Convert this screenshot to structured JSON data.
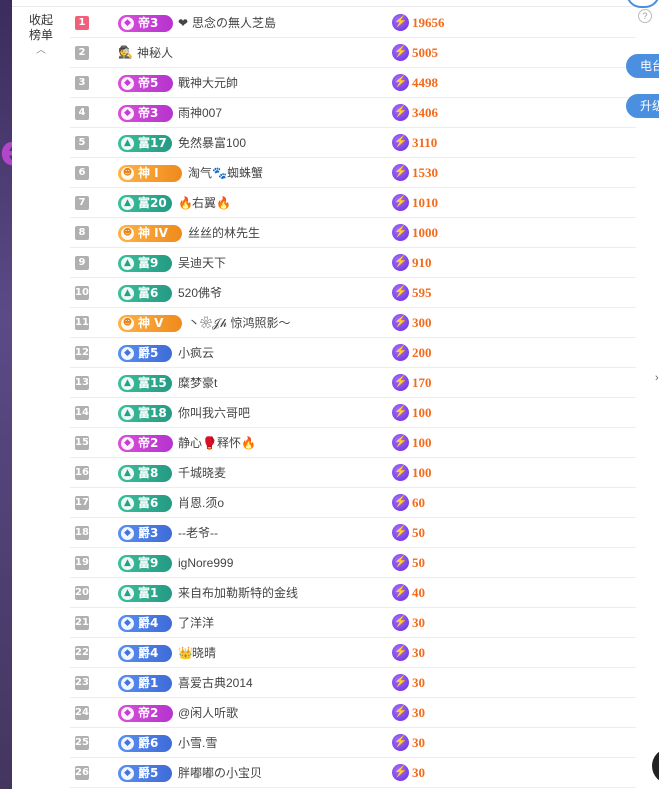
{
  "page": {
    "collapse_label": "收起\n榜单",
    "collapse_line1": "收起",
    "collapse_line2": "榜单",
    "chevron": "︿",
    "side_big_letter": "e"
  },
  "side_buttons": [
    {
      "label": "电台"
    },
    {
      "label": "升级"
    }
  ],
  "help_icon": "?",
  "colors": {
    "score": "#f46a1a",
    "di": "#c23ed3",
    "fu": "#27a088",
    "jue": "#4473da",
    "shen": "#f08a1c",
    "top_rank": "#f0607a",
    "side_button": "#4a8fe0"
  },
  "rows": [
    {
      "rank": "1",
      "badge": "帝3",
      "type": "di",
      "pre": "❤",
      "name": "思念の無人芝島",
      "score": "19656"
    },
    {
      "rank": "2",
      "badge": "",
      "type": "none",
      "pre": "🕵",
      "name": "神秘人",
      "score": "5005"
    },
    {
      "rank": "3",
      "badge": "帝5",
      "type": "di",
      "pre": "",
      "name": "戰神大元帥",
      "score": "4498"
    },
    {
      "rank": "4",
      "badge": "帝3",
      "type": "di",
      "pre": "",
      "name": "雨神007",
      "score": "3406"
    },
    {
      "rank": "5",
      "badge": "富17",
      "type": "fu",
      "pre": "",
      "name": "免然暴富100",
      "score": "3110"
    },
    {
      "rank": "6",
      "badge": "神 I",
      "type": "shen",
      "pre": "",
      "name": "淘气🐾蜘蛛蟹",
      "score": "1530"
    },
    {
      "rank": "7",
      "badge": "富20",
      "type": "fu",
      "pre": "🔥",
      "name": "右翼🔥",
      "score": "1010"
    },
    {
      "rank": "8",
      "badge": "神 IV",
      "type": "shen",
      "pre": "",
      "name": "丝丝的林先生",
      "score": "1000"
    },
    {
      "rank": "9",
      "badge": "富9",
      "type": "fu",
      "pre": "",
      "name": "吴迪天下",
      "score": "910"
    },
    {
      "rank": "10",
      "badge": "富6",
      "type": "fu",
      "pre": "",
      "name": "520佛爷",
      "score": "595"
    },
    {
      "rank": "11",
      "badge": "神 V",
      "type": "shen",
      "pre": "",
      "name": "丶❀𝒥𝒽 惊鸿照影～",
      "score": "300"
    },
    {
      "rank": "12",
      "badge": "爵5",
      "type": "jue",
      "pre": "",
      "name": "小疯云",
      "score": "200"
    },
    {
      "rank": "13",
      "badge": "富15",
      "type": "fu",
      "pre": "",
      "name": "糜梦豪t",
      "score": "170"
    },
    {
      "rank": "14",
      "badge": "富18",
      "type": "fu",
      "pre": "",
      "name": "你叫我六哥吧",
      "score": "100"
    },
    {
      "rank": "15",
      "badge": "帝2",
      "type": "di",
      "pre": "",
      "name": "静心🥊释怀🔥",
      "score": "100"
    },
    {
      "rank": "16",
      "badge": "富8",
      "type": "fu",
      "pre": "",
      "name": "千城晓麦",
      "score": "100"
    },
    {
      "rank": "17",
      "badge": "富6",
      "type": "fu",
      "pre": "",
      "name": "肖恩.须o",
      "score": "60"
    },
    {
      "rank": "18",
      "badge": "爵3",
      "type": "jue",
      "pre": "",
      "name": "--老爷--",
      "score": "50"
    },
    {
      "rank": "19",
      "badge": "富9",
      "type": "fu",
      "pre": "",
      "name": "igNore999",
      "score": "50"
    },
    {
      "rank": "20",
      "badge": "富1",
      "type": "fu",
      "pre": "",
      "name": "来自布加勒斯特的金线",
      "score": "40"
    },
    {
      "rank": "21",
      "badge": "爵4",
      "type": "jue",
      "pre": "",
      "name": "了洋洋",
      "score": "30"
    },
    {
      "rank": "22",
      "badge": "爵4",
      "type": "jue",
      "pre": "👑",
      "name": "晓晴",
      "score": "30"
    },
    {
      "rank": "23",
      "badge": "爵1",
      "type": "jue",
      "pre": "",
      "name": "喜爱古典2014",
      "score": "30"
    },
    {
      "rank": "24",
      "badge": "帝2",
      "type": "di",
      "pre": "",
      "name": "@闲人听歌",
      "score": "30"
    },
    {
      "rank": "25",
      "badge": "爵6",
      "type": "jue",
      "pre": "",
      "name": "小雪.雪",
      "score": "30"
    },
    {
      "rank": "26",
      "badge": "爵5",
      "type": "jue",
      "pre": "",
      "name": "胖嘟嘟の小宝贝",
      "score": "30"
    }
  ]
}
